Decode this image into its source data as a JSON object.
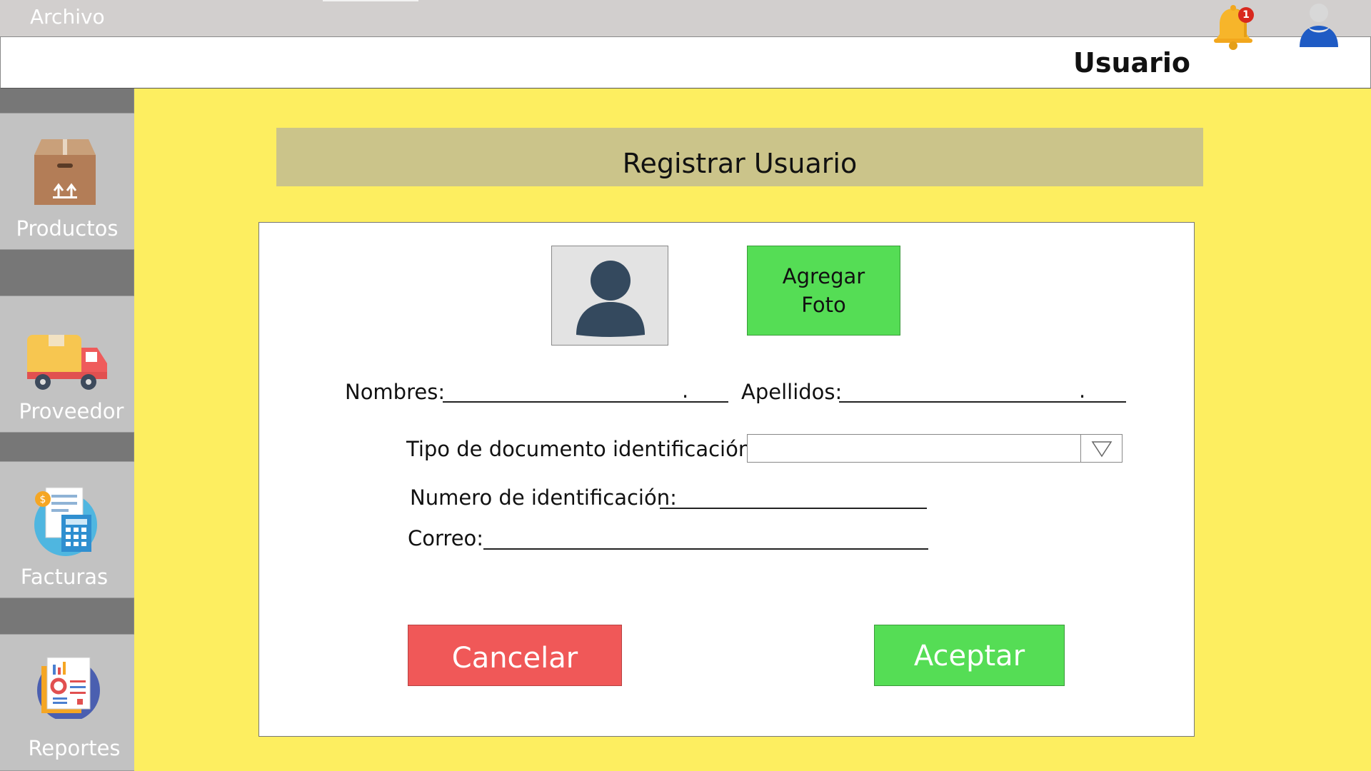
{
  "menubar": {
    "menu_label": "Archivo"
  },
  "topbar": {
    "user_label": "Usuario",
    "notification_count": "1"
  },
  "sidebar": {
    "items": [
      {
        "label": "Productos",
        "icon": "box-icon"
      },
      {
        "label": "Proveedor",
        "icon": "delivery-truck-icon"
      },
      {
        "label": "Facturas",
        "icon": "invoice-calculator-icon"
      },
      {
        "label": "Reportes",
        "icon": "reports-icon"
      }
    ]
  },
  "form": {
    "title": "Registrar Usuario",
    "add_photo_label": "Agregar\nFoto",
    "fields": {
      "nombres_label": "Nombres:",
      "apellidos_label": "Apellidos:",
      "tipo_documento_label": "Tipo de documento identificación:",
      "numero_identificacion_label": "Numero de identificación:",
      "correo_label": "Correo:",
      "dot": "."
    },
    "cancel_label": "Cancelar",
    "accept_label": "Aceptar"
  },
  "colors": {
    "background": "#fdee60",
    "title_bar": "#cbc48a",
    "accept_green": "#55dd55",
    "cancel_red": "#f05858",
    "sidebar_gray": "#777777"
  }
}
